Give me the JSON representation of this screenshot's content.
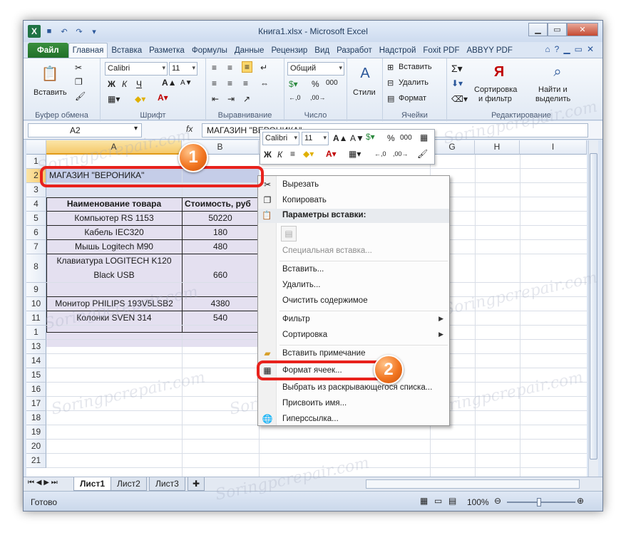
{
  "window": {
    "title": "Книга1.xlsx - Microsoft Excel",
    "qat_icons": [
      "excel-logo",
      "save-icon",
      "undo-icon",
      "redo-icon",
      "qat-customize-icon"
    ]
  },
  "tabs": [
    "Файл",
    "Главная",
    "Вставка",
    "Разметка",
    "Формулы",
    "Данные",
    "Рецензир",
    "Вид",
    "Разработ",
    "Надстрой",
    "Foxit PDF",
    "ABBYY PDF"
  ],
  "active_tab": "Главная",
  "ribbon": {
    "clipboard": {
      "label": "Буфер обмена",
      "paste": "Вставить"
    },
    "font": {
      "label": "Шрифт",
      "name": "Calibri",
      "size": "11",
      "bold": "Ж",
      "italic": "К",
      "underline": "Ч"
    },
    "alignment": {
      "label": "Выравнивание"
    },
    "number": {
      "label": "Число",
      "format": "Общий",
      "percent": "%",
      "thousands": "000"
    },
    "styles": {
      "label": "Стили"
    },
    "cells": {
      "label": "Ячейки",
      "insert": "Вставить",
      "delete": "Удалить",
      "format": "Формат"
    },
    "editing": {
      "label": "Редактирование",
      "sort": "Сортировка",
      "sort2": "и фильтр",
      "find": "Найти и",
      "find2": "выделить"
    }
  },
  "formula_bar": {
    "name_box": "A2",
    "fx": "fx",
    "content": "МАГАЗИН \"ВЕРОНИКА\""
  },
  "columns": [
    "A",
    "B",
    "C",
    "D",
    "E",
    "F",
    "G",
    "H",
    "I"
  ],
  "rows": [
    "1",
    "2",
    "3",
    "4",
    "5",
    "6",
    "7",
    "8",
    "9",
    "10",
    "11",
    "1",
    "13",
    "14",
    "15",
    "16",
    "17",
    "18",
    "19",
    "20",
    "21"
  ],
  "cells": {
    "a2": "МАГАЗИН \"ВЕРОНИКА\"",
    "header_a": "Наименование товара",
    "header_b": "Стоимость, руб",
    "items": [
      {
        "name": "Компьютер RS 1153",
        "price": "50220"
      },
      {
        "name": "Кабель IEC320",
        "price": "180"
      },
      {
        "name": "Мышь  Logitech M90",
        "price": "480"
      },
      {
        "name": "Клавиатура LOGITECH K120",
        "name2": "Black USB",
        "price": "660"
      },
      {
        "name": "Монитор PHILIPS 193V5LSB2",
        "price": "4380"
      },
      {
        "name": "Колонки  SVEN 314",
        "price": "540"
      }
    ]
  },
  "mini_toolbar": {
    "font": "Calibri",
    "size": "11",
    "bold": "Ж",
    "italic": "К",
    "percent": "%",
    "thousands": "000"
  },
  "context_menu": {
    "cut": "Вырезать",
    "copy": "Копировать",
    "paste_header": "Параметры вставки:",
    "paste_special": "Специальная вставка...",
    "insert": "Вставить...",
    "delete": "Удалить...",
    "clear": "Очистить содержимое",
    "filter": "Фильтр",
    "sort": "Сортировка",
    "comment": "Вставить примечание",
    "format_cells": "Формат ячеек...",
    "pick_list": "Выбрать из раскрывающегося списка...",
    "name": "Присвоить имя...",
    "hyperlink": "Гиперссылка..."
  },
  "sheets": [
    "Лист1",
    "Лист2",
    "Лист3"
  ],
  "active_sheet": "Лист1",
  "status": {
    "ready": "Готово",
    "zoom": "100%"
  },
  "badges": [
    "1",
    "2"
  ],
  "watermark": "Soringpcrepair.com",
  "colors": {
    "file_tab": "#2a7d2e",
    "selection": "#c5cde8",
    "highlight": "#e8221c",
    "badge": "#f27621"
  }
}
